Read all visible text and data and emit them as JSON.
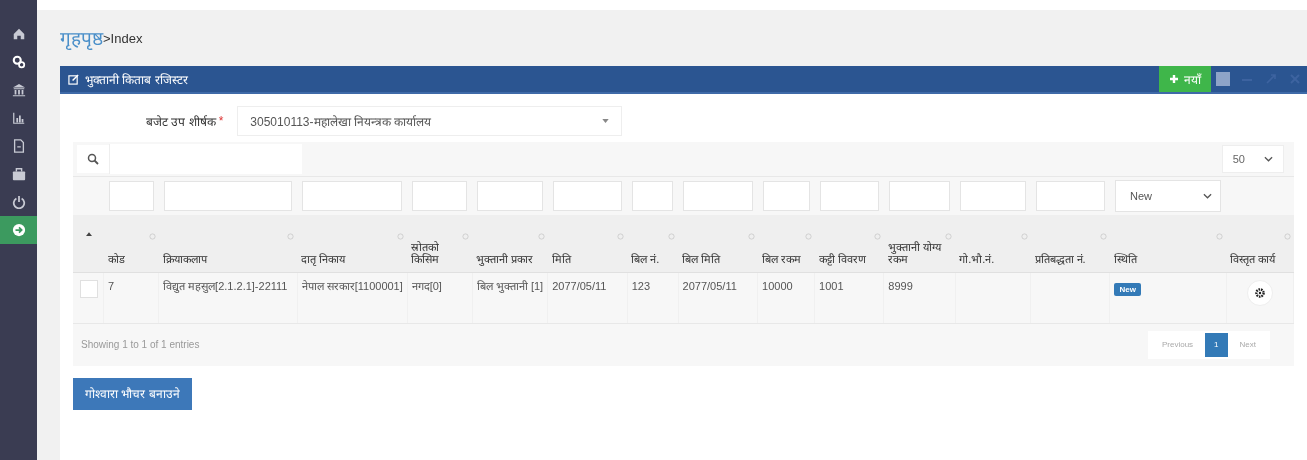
{
  "sidebar": {
    "items": [
      {
        "selected": false
      },
      {
        "selected": false
      },
      {
        "selected": false
      },
      {
        "selected": false
      },
      {
        "selected": false
      },
      {
        "selected": false
      },
      {
        "selected": false
      },
      {
        "selected": true
      }
    ]
  },
  "breadcrumb": {
    "home": "गृहपृष्ठ",
    "current": ">Index"
  },
  "panel": {
    "title": "भुक्तानी किताब रजिस्टर",
    "add_button": "नयाँ"
  },
  "budget": {
    "label": "बजेट उप शीर्षक",
    "required": "*",
    "value": "305010113-महालेखा नियन्त्रक कार्यालय"
  },
  "page_length": "50",
  "table": {
    "filters": [
      {
        "kind": "none"
      },
      {
        "kind": "text"
      },
      {
        "kind": "text"
      },
      {
        "kind": "text"
      },
      {
        "kind": "text"
      },
      {
        "kind": "text"
      },
      {
        "kind": "text"
      },
      {
        "kind": "text"
      },
      {
        "kind": "text"
      },
      {
        "kind": "text"
      },
      {
        "kind": "text"
      },
      {
        "kind": "text"
      },
      {
        "kind": "text"
      },
      {
        "kind": "text"
      },
      {
        "kind": "select",
        "value": "New"
      },
      {
        "kind": "none"
      }
    ],
    "columns": [
      {
        "kind": "sorted"
      },
      {
        "label": "कोड",
        "kind": "sortable"
      },
      {
        "label": "क्रियाकलाप",
        "kind": "sortable"
      },
      {
        "label": "दातृ निकाय",
        "kind": "sortable"
      },
      {
        "label": "स्रोतको किसिम",
        "kind": "sortable"
      },
      {
        "label": "भुक्तानी प्रकार",
        "kind": "sortable"
      },
      {
        "label": "मिति",
        "kind": "sortable"
      },
      {
        "label": "बिल नं.",
        "kind": "sortable"
      },
      {
        "label": "बिल मिति",
        "kind": "sortable"
      },
      {
        "label": "बिल रकम",
        "kind": "sortable"
      },
      {
        "label": "कट्टी विवरण",
        "kind": "sortable"
      },
      {
        "label": "भुक्तानी योग्य रकम",
        "kind": "sortable"
      },
      {
        "label": "गो.भौ.नं.",
        "kind": "sortable"
      },
      {
        "label": "प्रतिबद्धता नं.",
        "kind": "sortable"
      },
      {
        "label": "स्थिति",
        "kind": "sortable"
      },
      {
        "label": "विस्तृत कार्य",
        "kind": "sortable"
      }
    ],
    "rows": [
      {
        "checked": false,
        "cells": [
          "",
          "7",
          "विद्युत महसुल[2.1.2.1]-22111",
          "नेपाल सरकार[1100001]",
          "नगद[0]",
          "बिल भुक्तानी [1]",
          "2077/05/11",
          "123",
          "2077/05/11",
          "10000",
          "1001",
          "8999",
          "",
          "",
          "New"
        ]
      }
    ]
  },
  "info": "Showing 1 to 1 of 1 entries",
  "pagination": [
    {
      "label": "Previous",
      "kind": "prev",
      "selected": false
    },
    {
      "label": "1",
      "kind": "page",
      "selected": true
    },
    {
      "label": "Next",
      "kind": "next",
      "selected": false
    }
  ],
  "voucher_button": "गोश्वारा भौचर बनाउने"
}
